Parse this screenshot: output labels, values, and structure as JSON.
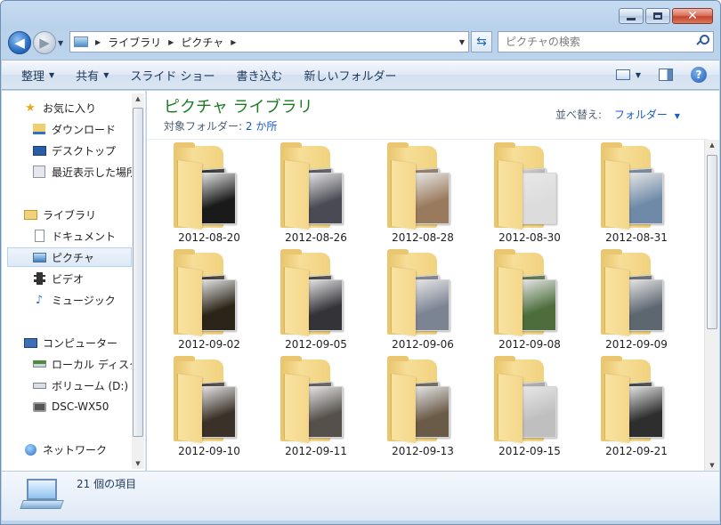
{
  "window": {
    "caption_min": "",
    "caption_max": "",
    "caption_close": "✕"
  },
  "address_bar": {
    "crumbs": [
      "ライブラリ",
      "ピクチャ"
    ],
    "search_placeholder": "ピクチャの検索"
  },
  "toolbar": {
    "organize": "整理",
    "share": "共有",
    "slideshow": "スライド ショー",
    "burn": "書き込む",
    "new_folder": "新しいフォルダー",
    "help": "?"
  },
  "nav": {
    "favorites": "お気に入り",
    "downloads": "ダウンロード",
    "desktop": "デスクトップ",
    "recent": "最近表示した場所",
    "libraries": "ライブラリ",
    "documents": "ドキュメント",
    "pictures": "ピクチャ",
    "videos": "ビデオ",
    "music": "ミュージック",
    "computer": "コンピューター",
    "local_disk": "ローカル ディスク",
    "volume_d": "ボリューム (D:)",
    "camera": "DSC-WX50",
    "network": "ネットワーク"
  },
  "content": {
    "title": "ピクチャ ライブラリ",
    "subtitle_prefix": "対象フォルダー:",
    "subtitle_link": "2 か所",
    "sort_label": "並べ替え:",
    "sort_value": "フォルダー",
    "folders": [
      "2012-08-20",
      "2012-08-26",
      "2012-08-28",
      "2012-08-30",
      "2012-08-31",
      "2012-09-02",
      "2012-09-05",
      "2012-09-06",
      "2012-09-08",
      "2012-09-09",
      "2012-09-10",
      "2012-09-11",
      "2012-09-13",
      "2012-09-15",
      "2012-09-21"
    ],
    "folder_photo_colors": [
      "#1a1a1a",
      "#4a4a55",
      "#9a7a5c",
      "#dcdcdc",
      "#6f8aa8",
      "#2b2418",
      "#333338",
      "#7c8494",
      "#4d6e3c",
      "#5c6770",
      "#3a3128",
      "#56504a",
      "#6a5a48",
      "#bfbfbf",
      "#2e2e2e"
    ]
  },
  "details": {
    "item_count": "21 個の項目"
  },
  "colors": {
    "title_green": "#1e7a24",
    "link_blue": "#1a5cc4"
  }
}
